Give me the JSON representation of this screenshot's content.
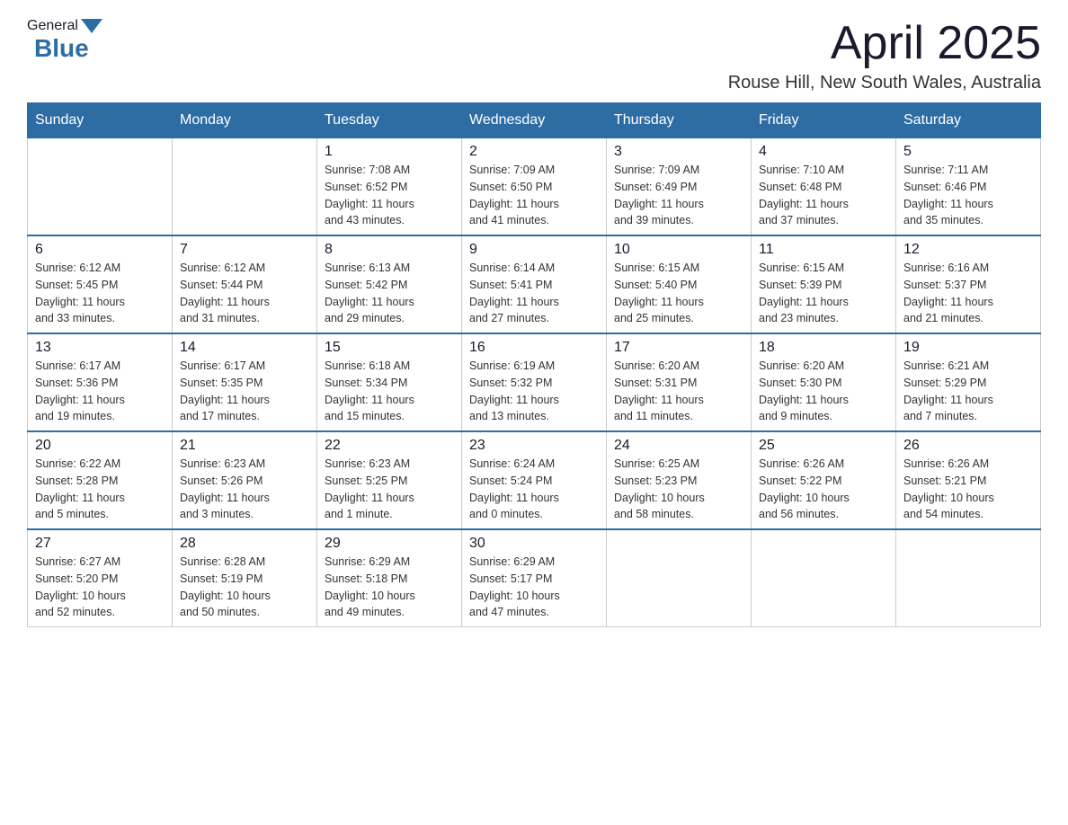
{
  "header": {
    "logo_general": "General",
    "logo_blue": "Blue",
    "month_title": "April 2025",
    "location": "Rouse Hill, New South Wales, Australia"
  },
  "days_of_week": [
    "Sunday",
    "Monday",
    "Tuesday",
    "Wednesday",
    "Thursday",
    "Friday",
    "Saturday"
  ],
  "weeks": [
    [
      {
        "day": "",
        "info": ""
      },
      {
        "day": "",
        "info": ""
      },
      {
        "day": "1",
        "info": "Sunrise: 7:08 AM\nSunset: 6:52 PM\nDaylight: 11 hours\nand 43 minutes."
      },
      {
        "day": "2",
        "info": "Sunrise: 7:09 AM\nSunset: 6:50 PM\nDaylight: 11 hours\nand 41 minutes."
      },
      {
        "day": "3",
        "info": "Sunrise: 7:09 AM\nSunset: 6:49 PM\nDaylight: 11 hours\nand 39 minutes."
      },
      {
        "day": "4",
        "info": "Sunrise: 7:10 AM\nSunset: 6:48 PM\nDaylight: 11 hours\nand 37 minutes."
      },
      {
        "day": "5",
        "info": "Sunrise: 7:11 AM\nSunset: 6:46 PM\nDaylight: 11 hours\nand 35 minutes."
      }
    ],
    [
      {
        "day": "6",
        "info": "Sunrise: 6:12 AM\nSunset: 5:45 PM\nDaylight: 11 hours\nand 33 minutes."
      },
      {
        "day": "7",
        "info": "Sunrise: 6:12 AM\nSunset: 5:44 PM\nDaylight: 11 hours\nand 31 minutes."
      },
      {
        "day": "8",
        "info": "Sunrise: 6:13 AM\nSunset: 5:42 PM\nDaylight: 11 hours\nand 29 minutes."
      },
      {
        "day": "9",
        "info": "Sunrise: 6:14 AM\nSunset: 5:41 PM\nDaylight: 11 hours\nand 27 minutes."
      },
      {
        "day": "10",
        "info": "Sunrise: 6:15 AM\nSunset: 5:40 PM\nDaylight: 11 hours\nand 25 minutes."
      },
      {
        "day": "11",
        "info": "Sunrise: 6:15 AM\nSunset: 5:39 PM\nDaylight: 11 hours\nand 23 minutes."
      },
      {
        "day": "12",
        "info": "Sunrise: 6:16 AM\nSunset: 5:37 PM\nDaylight: 11 hours\nand 21 minutes."
      }
    ],
    [
      {
        "day": "13",
        "info": "Sunrise: 6:17 AM\nSunset: 5:36 PM\nDaylight: 11 hours\nand 19 minutes."
      },
      {
        "day": "14",
        "info": "Sunrise: 6:17 AM\nSunset: 5:35 PM\nDaylight: 11 hours\nand 17 minutes."
      },
      {
        "day": "15",
        "info": "Sunrise: 6:18 AM\nSunset: 5:34 PM\nDaylight: 11 hours\nand 15 minutes."
      },
      {
        "day": "16",
        "info": "Sunrise: 6:19 AM\nSunset: 5:32 PM\nDaylight: 11 hours\nand 13 minutes."
      },
      {
        "day": "17",
        "info": "Sunrise: 6:20 AM\nSunset: 5:31 PM\nDaylight: 11 hours\nand 11 minutes."
      },
      {
        "day": "18",
        "info": "Sunrise: 6:20 AM\nSunset: 5:30 PM\nDaylight: 11 hours\nand 9 minutes."
      },
      {
        "day": "19",
        "info": "Sunrise: 6:21 AM\nSunset: 5:29 PM\nDaylight: 11 hours\nand 7 minutes."
      }
    ],
    [
      {
        "day": "20",
        "info": "Sunrise: 6:22 AM\nSunset: 5:28 PM\nDaylight: 11 hours\nand 5 minutes."
      },
      {
        "day": "21",
        "info": "Sunrise: 6:23 AM\nSunset: 5:26 PM\nDaylight: 11 hours\nand 3 minutes."
      },
      {
        "day": "22",
        "info": "Sunrise: 6:23 AM\nSunset: 5:25 PM\nDaylight: 11 hours\nand 1 minute."
      },
      {
        "day": "23",
        "info": "Sunrise: 6:24 AM\nSunset: 5:24 PM\nDaylight: 11 hours\nand 0 minutes."
      },
      {
        "day": "24",
        "info": "Sunrise: 6:25 AM\nSunset: 5:23 PM\nDaylight: 10 hours\nand 58 minutes."
      },
      {
        "day": "25",
        "info": "Sunrise: 6:26 AM\nSunset: 5:22 PM\nDaylight: 10 hours\nand 56 minutes."
      },
      {
        "day": "26",
        "info": "Sunrise: 6:26 AM\nSunset: 5:21 PM\nDaylight: 10 hours\nand 54 minutes."
      }
    ],
    [
      {
        "day": "27",
        "info": "Sunrise: 6:27 AM\nSunset: 5:20 PM\nDaylight: 10 hours\nand 52 minutes."
      },
      {
        "day": "28",
        "info": "Sunrise: 6:28 AM\nSunset: 5:19 PM\nDaylight: 10 hours\nand 50 minutes."
      },
      {
        "day": "29",
        "info": "Sunrise: 6:29 AM\nSunset: 5:18 PM\nDaylight: 10 hours\nand 49 minutes."
      },
      {
        "day": "30",
        "info": "Sunrise: 6:29 AM\nSunset: 5:17 PM\nDaylight: 10 hours\nand 47 minutes."
      },
      {
        "day": "",
        "info": ""
      },
      {
        "day": "",
        "info": ""
      },
      {
        "day": "",
        "info": ""
      }
    ]
  ]
}
